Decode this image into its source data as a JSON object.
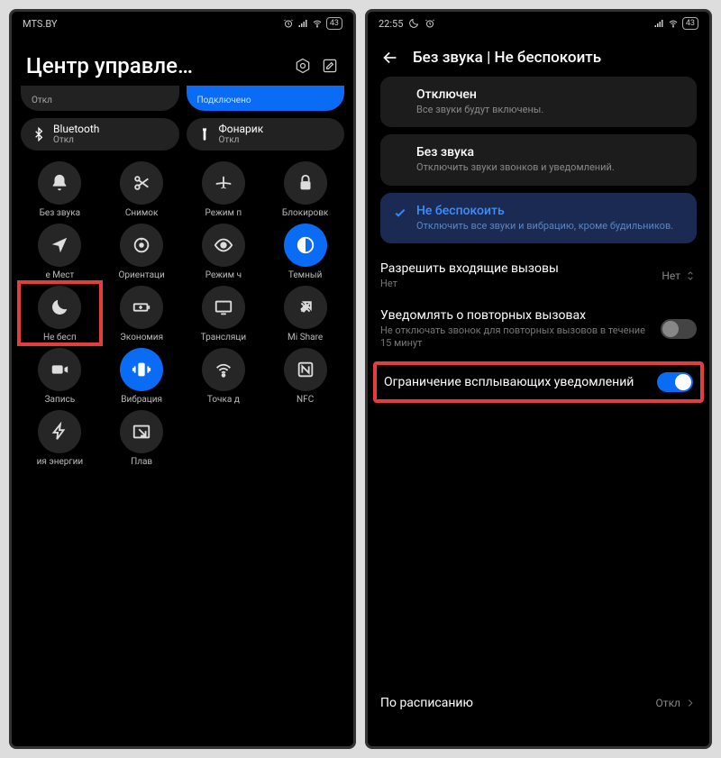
{
  "phone1": {
    "statusbar": {
      "carrier": "MTS.BY",
      "battery": "43"
    },
    "title": "Центр управле…",
    "partial_tiles": {
      "left_sub": "Откл",
      "right_sub": "Подключено"
    },
    "big_tiles": [
      {
        "label": "Bluetooth",
        "sub": "Откл",
        "icon": "bluetooth"
      },
      {
        "label": "Фонарик",
        "sub": "Откл",
        "icon": "flashlight"
      }
    ],
    "toggles": [
      {
        "label": "Без звука",
        "icon": "bell"
      },
      {
        "label": "Снимок",
        "icon": "scissors"
      },
      {
        "label": "Режим п",
        "icon": "airplane"
      },
      {
        "label": "Блокировк",
        "icon": "lock"
      },
      {
        "label": "е    Мест",
        "icon": "location"
      },
      {
        "label": "Ориентаци",
        "icon": "rotation"
      },
      {
        "label": "Режим ч",
        "icon": "eye"
      },
      {
        "label": "Темный",
        "icon": "darkmode",
        "active": true
      },
      {
        "label": "Не бесп",
        "icon": "moon",
        "highlight": true
      },
      {
        "label": "Экономия",
        "icon": "battery-save"
      },
      {
        "label": "Трансляци",
        "icon": "cast"
      },
      {
        "label": "Mi Share",
        "icon": "share"
      },
      {
        "label": "Запись",
        "icon": "record"
      },
      {
        "label": "Вибрация",
        "icon": "vibrate",
        "active": true
      },
      {
        "label": "Точка д",
        "icon": "hotspot"
      },
      {
        "label": "NFC",
        "icon": "nfc"
      },
      {
        "label": "ия энергии",
        "icon": "bolt"
      },
      {
        "label": "Плав",
        "icon": "pip"
      }
    ]
  },
  "phone2": {
    "statusbar": {
      "time": "22:55",
      "battery": "43"
    },
    "header_title": "Без звука | Не беспокоить",
    "options": [
      {
        "title": "Отключен",
        "sub": "Все звуки будут включены."
      },
      {
        "title": "Без звука",
        "sub": "Отключить звуки звонков и уведомлений."
      },
      {
        "title": "Не беспокоить",
        "sub": "Отключить все звуки и вибрацию, кроме будильников.",
        "selected": true
      }
    ],
    "settings": {
      "incoming": {
        "title": "Разрешить входящие вызовы",
        "sub": "Нет",
        "value": "Нет"
      },
      "repeat": {
        "title": "Уведомлять о повторных вызовах",
        "sub": "Не отключать звонок для повторных вызовов в течение 15 минут",
        "switch": false
      },
      "popup": {
        "title": "Ограничение всплывающих уведомлений",
        "switch": true,
        "highlight": true
      },
      "schedule": {
        "title": "По расписанию",
        "value": "Откл"
      }
    }
  }
}
